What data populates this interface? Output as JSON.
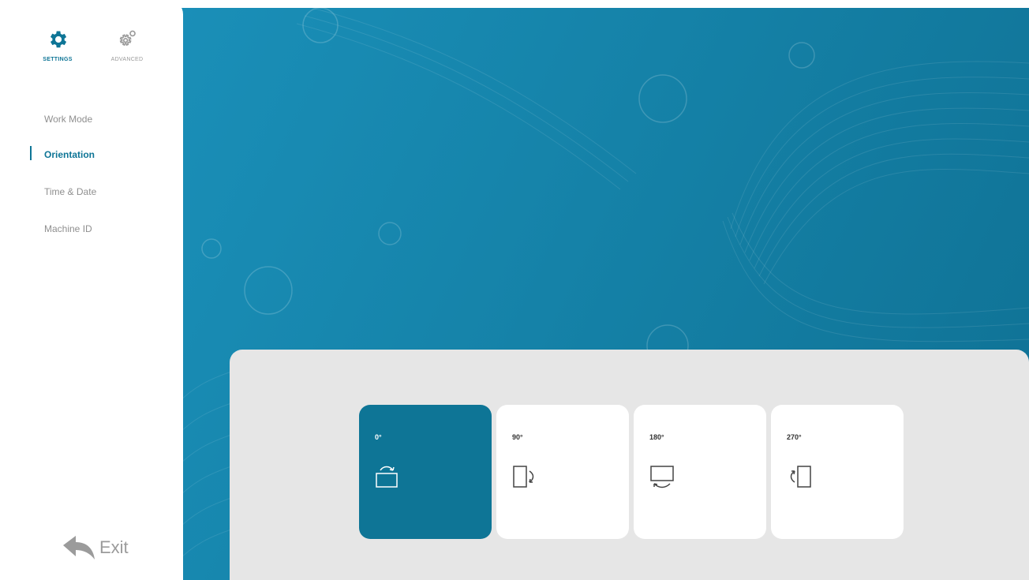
{
  "sidebar": {
    "tabs": [
      {
        "label": "SETTINGS",
        "icon": "gear-icon",
        "active": true
      },
      {
        "label": "ADVANCED",
        "icon": "gears-icon",
        "active": false
      }
    ],
    "menu": [
      {
        "label": "Work Mode",
        "active": false
      },
      {
        "label": "Orientation",
        "active": true
      },
      {
        "label": "Time & Date",
        "active": false
      },
      {
        "label": "Machine ID",
        "active": false
      }
    ],
    "exit": {
      "label": "Exit",
      "icon": "back-arrow-icon"
    }
  },
  "orientation": {
    "selected": "0°",
    "options": [
      {
        "label": "0°",
        "icon": "landscape-rotate-icon"
      },
      {
        "label": "90°",
        "icon": "portrait-rotate-right-icon"
      },
      {
        "label": "180°",
        "icon": "landscape-flipped-icon"
      },
      {
        "label": "270°",
        "icon": "portrait-rotate-left-icon"
      }
    ]
  },
  "colors": {
    "accent": "#0e7596",
    "background": "#1582a8",
    "panel": "#e6e6e6",
    "inactive_text": "#8f8f8f"
  }
}
